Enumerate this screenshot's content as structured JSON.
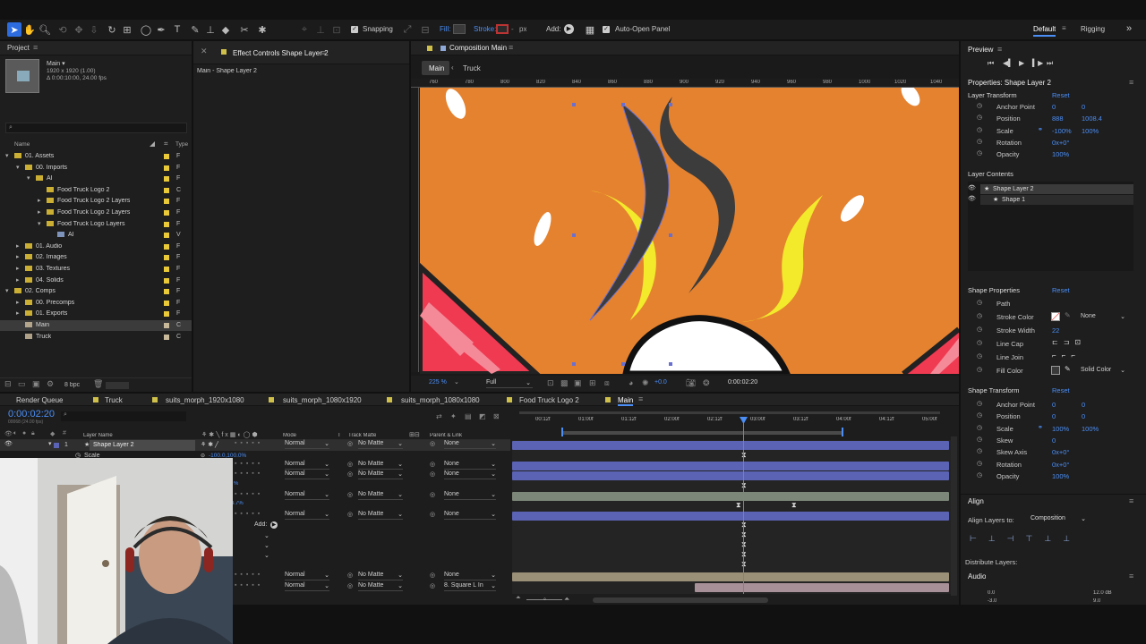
{
  "toolbar": {
    "snapping": "Snapping",
    "fill": "Fill:",
    "stroke": "Stroke:",
    "px": "px",
    "add": "Add:",
    "auto_open": "Auto-Open Panel",
    "workspaces": [
      "Default",
      "Rigging"
    ]
  },
  "project": {
    "title": "Project",
    "comp_name": "Main ▾",
    "comp_info": [
      "1920 x 1920 (1.00)",
      "Δ 0:00:10:00, 24.00 fps"
    ],
    "search_placeholder": "",
    "col_name": "Name",
    "col_type": "Type",
    "items": [
      {
        "label": "01. Assets",
        "indent": 0,
        "arrow": "▾",
        "color": "#e9c938",
        "type": "F"
      },
      {
        "label": "00. Imports",
        "indent": 1,
        "arrow": "▾",
        "color": "#e9c938",
        "type": "F"
      },
      {
        "label": "AI",
        "indent": 2,
        "arrow": "▾",
        "color": "#e9c938",
        "type": "F"
      },
      {
        "label": "Food Truck Logo 2",
        "indent": 3,
        "arrow": "",
        "color": "#e9c938",
        "type": "C"
      },
      {
        "label": "Food Truck Logo 2 Layers",
        "indent": 3,
        "arrow": "▸",
        "color": "#e9c938",
        "type": "F"
      },
      {
        "label": "Food Truck Logo 2 Layers",
        "indent": 3,
        "arrow": "▸",
        "color": "#e9c938",
        "type": "F"
      },
      {
        "label": "Food Truck Logo Layers",
        "indent": 3,
        "arrow": "▾",
        "color": "#e9c938",
        "type": "F"
      },
      {
        "label": "AI",
        "indent": 4,
        "arrow": "",
        "color": "#8ea8d8",
        "type": "V"
      },
      {
        "label": "01. Audio",
        "indent": 1,
        "arrow": "▸",
        "color": "#e9c938",
        "type": "F"
      },
      {
        "label": "02. Images",
        "indent": 1,
        "arrow": "▸",
        "color": "#e9c938",
        "type": "F"
      },
      {
        "label": "03. Textures",
        "indent": 1,
        "arrow": "▸",
        "color": "#e9c938",
        "type": "F"
      },
      {
        "label": "04. Solids",
        "indent": 1,
        "arrow": "▸",
        "color": "#e9c938",
        "type": "F"
      },
      {
        "label": "02. Comps",
        "indent": 0,
        "arrow": "▾",
        "color": "#e9c938",
        "type": "F"
      },
      {
        "label": "00. Precomps",
        "indent": 1,
        "arrow": "▸",
        "color": "#e9c938",
        "type": "F"
      },
      {
        "label": "01. Exports",
        "indent": 1,
        "arrow": "▸",
        "color": "#e9c938",
        "type": "F"
      },
      {
        "label": "Main",
        "indent": 1,
        "arrow": "",
        "color": "#c8b89a",
        "type": "C",
        "selected": true
      },
      {
        "label": "Truck",
        "indent": 1,
        "arrow": "",
        "color": "#c8b89a",
        "type": "C"
      }
    ],
    "bpc": "8 bpc"
  },
  "effect_controls": {
    "title": "Effect Controls Shape Layer 2",
    "subtitle": "Main - Shape Layer 2"
  },
  "composition": {
    "title": "Composition Main",
    "tabs": [
      "Main",
      "Truck"
    ],
    "ruler": [
      "760",
      "780",
      "800",
      "820",
      "840",
      "860",
      "880",
      "900",
      "920",
      "940",
      "960",
      "980",
      "1000",
      "1020",
      "1040"
    ],
    "zoom": "225 %",
    "resolution": "Full",
    "exposure": "+0.0",
    "timecode": "0:00:02:20"
  },
  "preview": {
    "title": "Preview"
  },
  "properties": {
    "title": "Properties: Shape Layer 2",
    "layer_transform": "Layer Transform",
    "reset": "Reset",
    "transform": [
      {
        "label": "Anchor Point",
        "v1": "0",
        "v2": "0"
      },
      {
        "label": "Position",
        "v1": "888",
        "v2": "1008.4"
      },
      {
        "label": "Scale",
        "v1": "-100%",
        "v2": "100%"
      },
      {
        "label": "Rotation",
        "v1": "0x+0°",
        "v2": ""
      },
      {
        "label": "Opacity",
        "v1": "100%",
        "v2": ""
      }
    ],
    "layer_contents": "Layer Contents",
    "contents": [
      "Shape Layer 2",
      "Shape 1"
    ],
    "shape_properties": "Shape Properties",
    "shape_props": [
      {
        "label": "Path"
      },
      {
        "label": "Stroke Color",
        "extra": "None"
      },
      {
        "label": "Stroke Width",
        "value": "22"
      },
      {
        "label": "Line Cap"
      },
      {
        "label": "Line Join"
      },
      {
        "label": "Fill Color",
        "extra": "Solid Color"
      }
    ],
    "shape_transform": "Shape Transform",
    "shape_tf": [
      {
        "label": "Anchor Point",
        "v1": "0",
        "v2": "0"
      },
      {
        "label": "Position",
        "v1": "0",
        "v2": "0"
      },
      {
        "label": "Scale",
        "v1": "100%",
        "v2": "100%"
      },
      {
        "label": "Skew",
        "v1": "0",
        "v2": ""
      },
      {
        "label": "Skew Axis",
        "v1": "0x+0°",
        "v2": ""
      },
      {
        "label": "Rotation",
        "v1": "0x+0°",
        "v2": ""
      },
      {
        "label": "Opacity",
        "v1": "100%",
        "v2": ""
      }
    ],
    "align": "Align",
    "align_to_label": "Align Layers to:",
    "align_to": "Composition",
    "distribute": "Distribute Layers:",
    "audio": "Audio",
    "audio_vals": [
      "0.0",
      "-3.0",
      "12.0 dB",
      "9.0"
    ]
  },
  "timeline": {
    "tabs": [
      "Render Queue",
      "Truck",
      "suits_morph_1920x1080",
      "suits_morph_1080x1920",
      "suits_morph_1080x1080",
      "Food Truck Logo 2",
      "Main"
    ],
    "timecode": "0:00:02:20",
    "fps": "00068 (24.00 fps)",
    "cols": {
      "layer_name": "Layer Name",
      "mode": "Mode",
      "t": "T",
      "track_matte": "Track Matte",
      "parent": "Parent & Link"
    },
    "ruler": [
      "00:12f",
      "01:00f",
      "01:12f",
      "02:00f",
      "02:12f",
      "03:00f",
      "03:12f",
      "04:00f",
      "04:12f",
      "05:00f"
    ],
    "layer": {
      "num": "1",
      "name": "Shape Layer 2",
      "prop": "Scale",
      "prop_val": "-100.0,100.0%"
    },
    "rows": [
      {
        "mode": "Normal",
        "matte": "No Matte",
        "parent": "None"
      },
      {
        "mode": "Normal",
        "matte": "No Matte",
        "parent": "None"
      },
      {
        "mode": "Normal",
        "matte": "No Matte",
        "parent": "None"
      },
      {
        "mode": "Normal",
        "matte": "No Matte",
        "parent": "None"
      },
      {
        "mode": "Normal",
        "matte": "No Matte",
        "parent": "None"
      },
      {
        "mode": "Normal",
        "matte": "No Matte",
        "parent": "None"
      },
      {
        "mode": "Normal",
        "matte": "No Matte",
        "parent": "8. Square L In"
      }
    ],
    "partial": [
      "%",
      "4.7%"
    ],
    "add": "Add:"
  },
  "colors": {
    "accent": "#4b8ef5",
    "comp_bg": "#e5822f",
    "flame_dark": "#3c3c3c",
    "flame_yellow": "#f2ea2b",
    "stripe_red": "#ef3a52",
    "stripe_pink": "#f48a98",
    "layer_bar": "#5b63b5",
    "gray_bar": "#7d8779",
    "tan_bar": "#9a8f77",
    "pink_bar": "#a89099"
  }
}
